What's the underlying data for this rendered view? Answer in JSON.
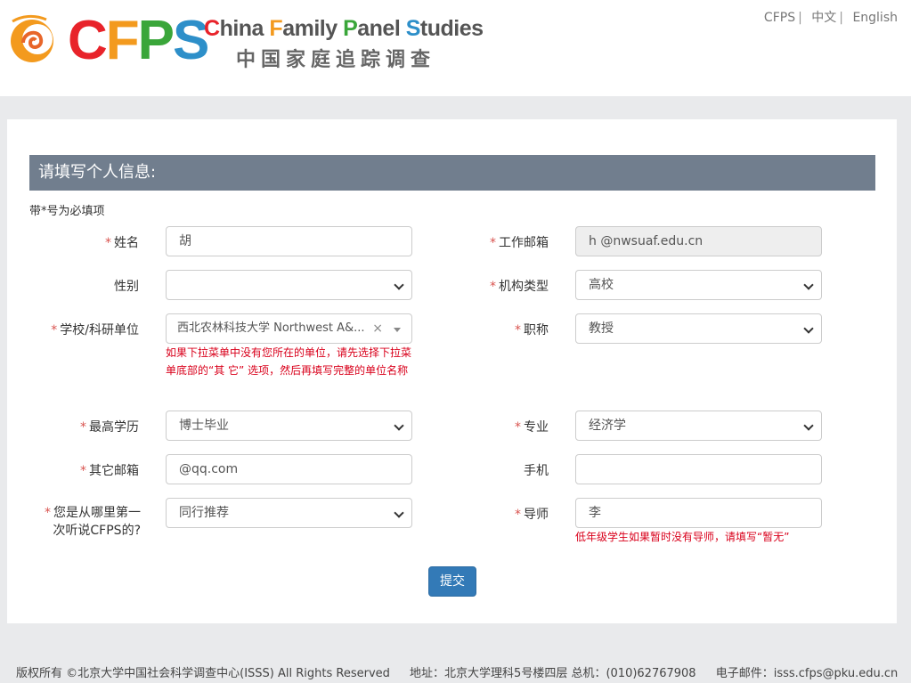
{
  "header": {
    "logo_text": "CFPS",
    "title_en": "China Family Panel Studies",
    "title_cn": "中国家庭追踪调查",
    "lang_links": [
      "CFPS",
      "中文",
      "English"
    ]
  },
  "form": {
    "title": "请填写个人信息:",
    "required_note": "带*号为必填项",
    "fields": {
      "name": {
        "label": "姓名",
        "value": "胡",
        "required": true
      },
      "gender": {
        "label": "性别",
        "value": "",
        "required": false
      },
      "school": {
        "label": "学校/科研单位",
        "value": "西北农林科技大学 Northwest A&...",
        "required": true
      },
      "school_hint": "如果下拉菜单中没有您所在的单位，请先选择下拉菜单底部的“其 它” 选项，然后再填写完整的单位名称",
      "degree": {
        "label": "最高学历",
        "value": "博士毕业",
        "required": true
      },
      "other_email": {
        "label": "其它邮箱",
        "value": "@qq.com",
        "required": true
      },
      "heard_from": {
        "label": "您是从哪里第一次听说CFPS的?",
        "value": "同行推荐",
        "required": true
      },
      "work_email": {
        "label": "工作邮箱",
        "value": "h @nwsuaf.edu.cn",
        "required": true
      },
      "org_type": {
        "label": "机构类型",
        "value": "高校",
        "required": true
      },
      "title": {
        "label": "职称",
        "value": "教授",
        "required": true
      },
      "major": {
        "label": "专业",
        "value": "经济学",
        "required": true
      },
      "phone": {
        "label": "手机",
        "value": "",
        "required": false
      },
      "advisor": {
        "label": "导师",
        "value": "李",
        "required": true
      },
      "advisor_hint": "低年级学生如果暂时没有导师，请填写“暂无”"
    },
    "submit_label": "提交"
  },
  "footer": {
    "copyright": "版权所有 ©北京大学中国社会科学调查中心(ISSS) All Rights Reserved",
    "address": "地址：北京大学理科5号楼四层 总机：(010)62767908",
    "email": "电子邮件：isss.cfps@pku.edu.cn"
  },
  "colors": {
    "accent": "#717e8e",
    "button": "#337ab7",
    "required": "#d9534f",
    "hint": "#d9001b"
  }
}
